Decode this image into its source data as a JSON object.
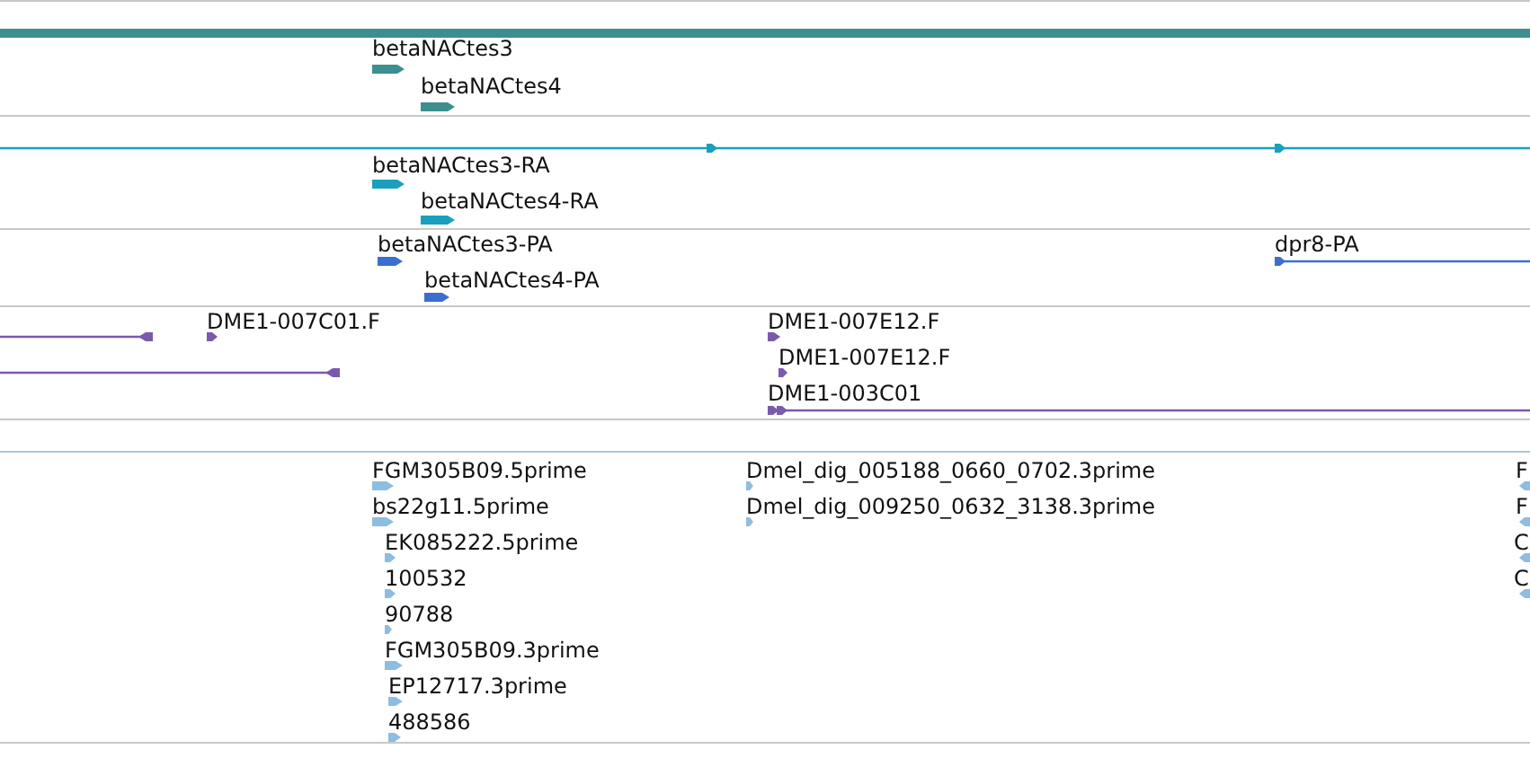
{
  "tracks": [
    {
      "color": "#3d8f8f",
      "features": [
        {
          "kind": "bar"
        },
        {
          "kind": "box",
          "label": "betaNACtes3",
          "reverse": false
        },
        {
          "kind": "box",
          "label": "betaNACtes4",
          "reverse": false
        }
      ]
    },
    {
      "color": "#1aa0bd",
      "features": [
        {
          "kind": "line",
          "reverse": false
        },
        {
          "kind": "box",
          "label": "betaNACtes3-RA",
          "reverse": false
        },
        {
          "kind": "box",
          "label": "betaNACtes4-RA",
          "reverse": false
        }
      ]
    },
    {
      "color": "#3a6fd0",
      "features": [
        {
          "kind": "box",
          "label": "betaNACtes3-PA",
          "reverse": false
        },
        {
          "kind": "box",
          "label": "betaNACtes4-PA",
          "reverse": false
        },
        {
          "kind": "line",
          "label": "dpr8-PA",
          "reverse": false
        }
      ]
    },
    {
      "color": "#7a5aad",
      "features": [
        {
          "kind": "line",
          "reverse": true
        },
        {
          "kind": "box",
          "label": "DME1-007C01.F",
          "reverse": false
        },
        {
          "kind": "line",
          "reverse": true
        },
        {
          "kind": "box",
          "label": "DME1-007E12.F",
          "reverse": false
        },
        {
          "kind": "box",
          "label": "DME1-007E12.F",
          "reverse": false
        },
        {
          "kind": "line",
          "label": "DME1-003C01",
          "reverse": false
        }
      ]
    },
    {
      "color": "#8dbde0",
      "features": [
        {
          "kind": "box",
          "label": "FGM305B09.5prime",
          "reverse": false
        },
        {
          "kind": "box",
          "label": "bs22g11.5prime",
          "reverse": false
        },
        {
          "kind": "box",
          "label": "EK085222.5prime",
          "reverse": false
        },
        {
          "kind": "box",
          "label": "100532",
          "reverse": false
        },
        {
          "kind": "box",
          "label": "90788",
          "reverse": false
        },
        {
          "kind": "box",
          "label": "FGM305B09.3prime",
          "reverse": false
        },
        {
          "kind": "box",
          "label": "EP12717.3prime",
          "reverse": false
        },
        {
          "kind": "box",
          "label": "488586",
          "reverse": false
        },
        {
          "kind": "box",
          "label": "Dmel_dig_005188_0660_0702.3prime",
          "reverse": false
        },
        {
          "kind": "box",
          "label": "Dmel_dig_009250_0632_3138.3prime",
          "reverse": false
        },
        {
          "kind": "box",
          "label": "F",
          "reverse": true
        },
        {
          "kind": "box",
          "label": "F",
          "reverse": true
        },
        {
          "kind": "box",
          "label": "C",
          "reverse": true
        },
        {
          "kind": "box",
          "label": "C",
          "reverse": true
        }
      ]
    }
  ]
}
